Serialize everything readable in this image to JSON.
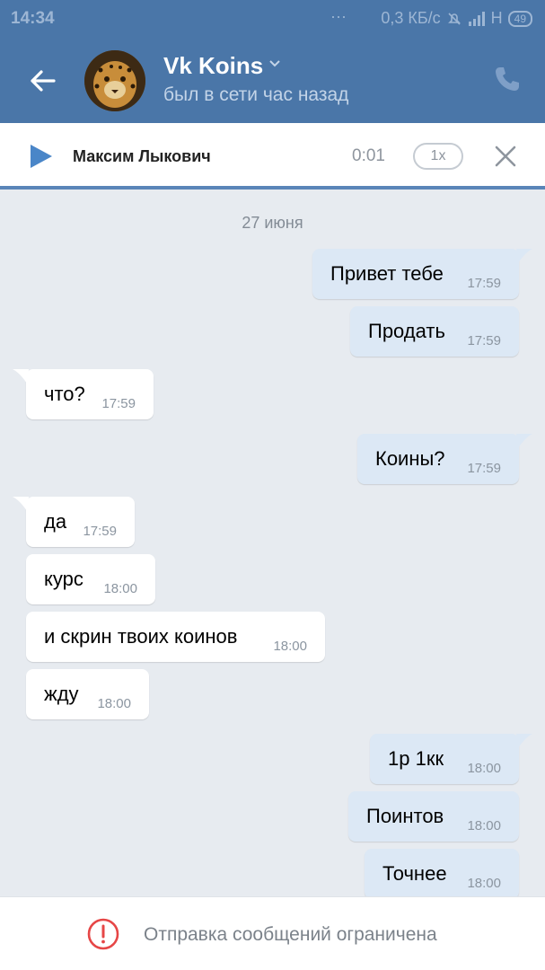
{
  "status": {
    "time": "14:34",
    "net": "0,3 КБ/с",
    "signal": "H",
    "battery": "49"
  },
  "header": {
    "title": "Vk Koins",
    "subtitle": "был в сети час назад"
  },
  "player": {
    "track": "Максим Лыкович",
    "time": "0:01",
    "speed": "1x"
  },
  "chat": {
    "date": "27 июня",
    "messages": [
      {
        "dir": "out",
        "text": "Привет тебе",
        "time": "17:59"
      },
      {
        "dir": "out",
        "text": "Продать",
        "time": "17:59"
      },
      {
        "dir": "in",
        "text": "что?",
        "time": "17:59"
      },
      {
        "dir": "out",
        "text": "Коины?",
        "time": "17:59"
      },
      {
        "dir": "in",
        "text": "да",
        "time": "17:59"
      },
      {
        "dir": "in",
        "text": "курс",
        "time": "18:00"
      },
      {
        "dir": "in",
        "text": "и скрин твоих коинов",
        "time": "18:00"
      },
      {
        "dir": "in",
        "text": "жду",
        "time": "18:00"
      },
      {
        "dir": "out",
        "text": "1р 1кк",
        "time": "18:00"
      },
      {
        "dir": "out",
        "text": "Поинтов",
        "time": "18:00"
      },
      {
        "dir": "out",
        "text": "Точнее",
        "time": "18:00"
      }
    ]
  },
  "footer": {
    "restriction": "Отправка сообщений ограничена"
  },
  "colors": {
    "accent": "#4a76a8",
    "outgoing": "#dce8f5",
    "incoming": "#ffffff",
    "warning": "#e64646"
  }
}
